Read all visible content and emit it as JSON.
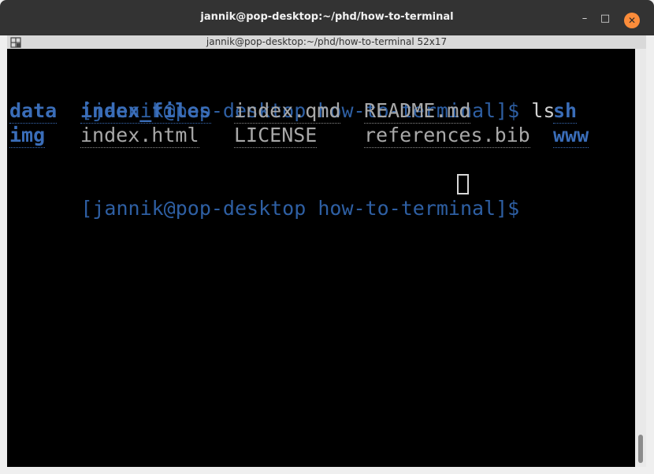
{
  "window": {
    "title": "jannik@pop-desktop:~/phd/how-to-terminal",
    "tab_title": "jannik@pop-desktop:~/phd/how-to-terminal 52x17",
    "minimize_symbol": "–",
    "maximize_symbol": "□",
    "close_symbol": "✕",
    "tab_icon": "terminal-tab-icon"
  },
  "terminal": {
    "prompt1": "[jannik@pop-desktop how-to-terminal]$",
    "command1": " ls",
    "listing": {
      "row1": [
        "data",
        "index_files",
        "index.qmd",
        "README.md",
        "sh"
      ],
      "row2": [
        "img",
        "index.html",
        "LICENSE",
        "references.bib",
        "www"
      ]
    },
    "prompt2": "[jannik@pop-desktop how-to-terminal]$",
    "cursor": ""
  },
  "colors": {
    "prompt": "#2e5fa3",
    "directory": "#3a6db8",
    "file": "#a8a8a8",
    "background": "#000000",
    "titlebar": "#333333",
    "close_button": "#fb8c3a"
  }
}
